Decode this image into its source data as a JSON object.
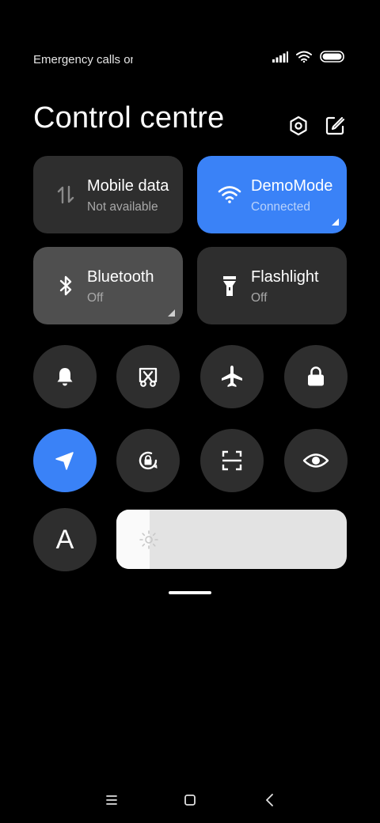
{
  "status_bar": {
    "text": "Emergency calls only",
    "icons": [
      "signal-icon",
      "wifi-icon",
      "battery-icon"
    ]
  },
  "header": {
    "title": "Control centre",
    "icons": [
      "settings-icon",
      "edit-icon"
    ]
  },
  "tiles": [
    {
      "label": "Mobile data",
      "sub": "Not available",
      "icon": "mobile-data-icon",
      "state": "unavailable"
    },
    {
      "label": "DemoMode",
      "sub": "Connected",
      "icon": "wifi-icon",
      "state": "on"
    },
    {
      "label": "Bluetooth",
      "sub": "Off",
      "icon": "bluetooth-icon",
      "state": "off"
    },
    {
      "label": "Flashlight",
      "sub": "Off",
      "icon": "flashlight-icon",
      "state": "off"
    }
  ],
  "toggles": [
    {
      "icon": "bell-icon",
      "active": false
    },
    {
      "icon": "screenshot-icon",
      "active": false
    },
    {
      "icon": "airplane-icon",
      "active": false
    },
    {
      "icon": "lock-icon",
      "active": false
    },
    {
      "icon": "location-icon",
      "active": true
    },
    {
      "icon": "rotation-lock-icon",
      "active": false
    },
    {
      "icon": "scanner-icon",
      "active": false
    },
    {
      "icon": "reading-mode-icon",
      "active": false
    }
  ],
  "auto_brightness": {
    "label": "A"
  },
  "brightness": {
    "level": 0.145,
    "icon": "sun-icon"
  },
  "navbar": {
    "buttons": [
      "menu-button",
      "home-button",
      "back-button"
    ]
  },
  "colors": {
    "accent": "#3a82f7",
    "tile": "#2e2e2e",
    "background": "#000000"
  }
}
